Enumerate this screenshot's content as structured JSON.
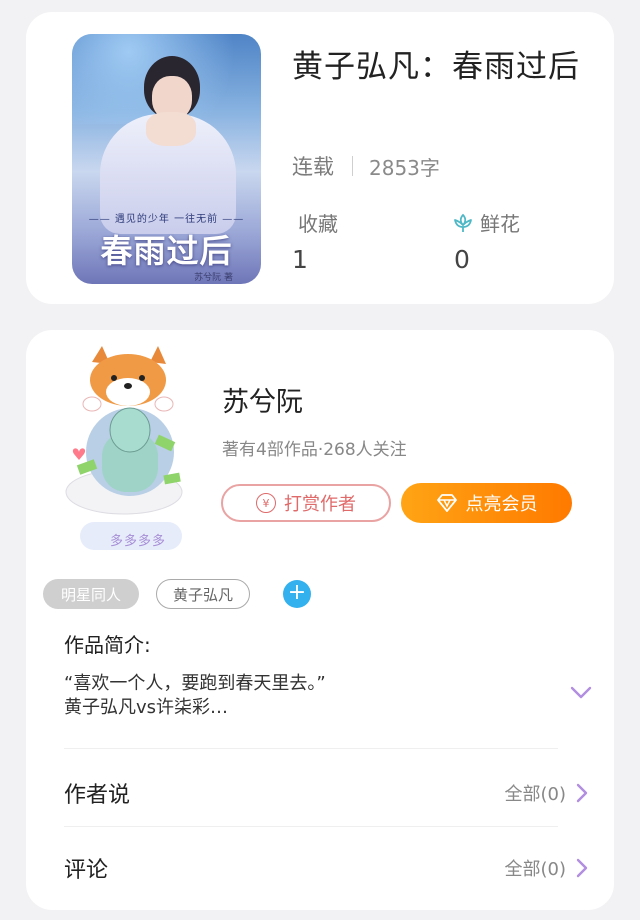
{
  "book": {
    "title": "黄子弘凡：春雨过后",
    "status": "连载",
    "word_count": "2853字",
    "cover": {
      "tagline": "—— 遇见的少年 一往无前 ——",
      "title": "春雨过后",
      "author": "苏兮阮 著"
    },
    "stats": [
      {
        "label": "收藏",
        "value": "1",
        "icon": ""
      },
      {
        "label": "鲜花",
        "value": "0",
        "icon": "flower-icon"
      }
    ]
  },
  "author": {
    "name": "苏兮阮",
    "info": "著有4部作品·268人关注",
    "avatar_badge": "多多多多",
    "reward_label": "打赏作者",
    "reward_icon": "¥",
    "vip_label": "点亮会员"
  },
  "tags": [
    "明星同人",
    "黄子弘凡"
  ],
  "tag_add_icon": "+",
  "intro": {
    "label": "作品简介:",
    "line1": "“喜欢一个人，要跑到春天里去。”",
    "line2": "黄子弘凡vs许柒彩…"
  },
  "rows": [
    {
      "title": "作者说",
      "right": "全部(0)"
    },
    {
      "title": "评论",
      "right": "全部(0)"
    }
  ],
  "colors": {
    "accent_orange": "#ff8c0a",
    "reward_red": "#e06a6a",
    "tag_blue": "#33b0ee",
    "chevron_purple": "#b28ee0",
    "flower_teal": "#4fb8c6"
  }
}
